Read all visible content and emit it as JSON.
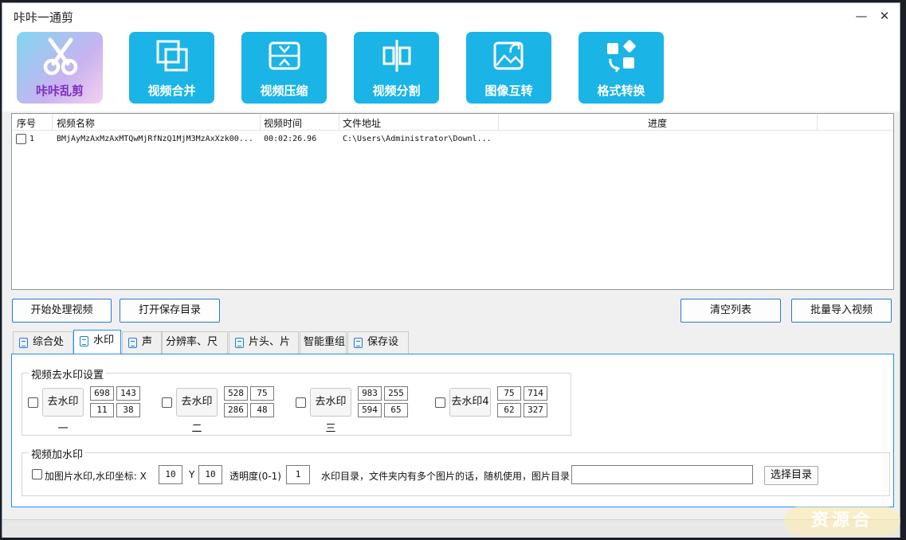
{
  "window": {
    "title": "咔咔一通剪",
    "minimize_symbol": "—",
    "close_symbol": "✕"
  },
  "toolbar": {
    "logo_label": "咔咔乱剪",
    "buttons": [
      {
        "label": "视频合并",
        "icon": "merge-icon"
      },
      {
        "label": "视频压缩",
        "icon": "compress-icon"
      },
      {
        "label": "视频分割",
        "icon": "split-icon"
      },
      {
        "label": "图像互转",
        "icon": "image-convert-icon"
      },
      {
        "label": "格式转换",
        "icon": "format-convert-icon"
      }
    ]
  },
  "file_list": {
    "columns": [
      "序号",
      "视频名称",
      "视频时间",
      "文件地址",
      "进度"
    ],
    "rows": [
      {
        "index": "1",
        "name": "BMjAyMzAxMzAxMTQwMjRfNzQ1MjM3MzAxXzk00...",
        "duration": "00:02:26.96",
        "path": "C:\\Users\\Administrator\\Downl...",
        "progress": ""
      }
    ]
  },
  "actions": {
    "start": "开始处理视频",
    "open_dir": "打开保存目录",
    "clear": "清空列表",
    "import": "批量导入视频"
  },
  "tabs": [
    "综合处理",
    "水印",
    "声音",
    "分辨率、尺寸",
    "片头、片尾",
    "智能重组",
    "保存设置"
  ],
  "active_tab": "水印",
  "remove_watermark": {
    "title": "视频去水印设置",
    "items": [
      {
        "label": "去水印一",
        "x": "698",
        "y": "143",
        "w": "11",
        "h": "38"
      },
      {
        "label": "去水印二",
        "x": "528",
        "y": "75",
        "w": "286",
        "h": "48"
      },
      {
        "label": "去水印三",
        "x": "983",
        "y": "255",
        "w": "594",
        "h": "65"
      },
      {
        "label": "去水印4",
        "x": "75",
        "y": "714",
        "w": "62",
        "h": "327"
      }
    ]
  },
  "add_watermark": {
    "title": "视频加水印",
    "checkbox_label": "加图片水印,水印坐标: X",
    "x_value": "10",
    "y_label": "Y",
    "y_value": "10",
    "opacity_label": "透明度(0-1)",
    "opacity_value": "1",
    "dir_label": "水印目录，文件夹内有多个图片的话，随机使用，图片目录",
    "dir_value": "",
    "choose_dir": "选择目录"
  },
  "watermark_overlay": "资源合",
  "colors": {
    "tool_blue": "#1bb4e6",
    "accent_border": "#1e90ff"
  }
}
